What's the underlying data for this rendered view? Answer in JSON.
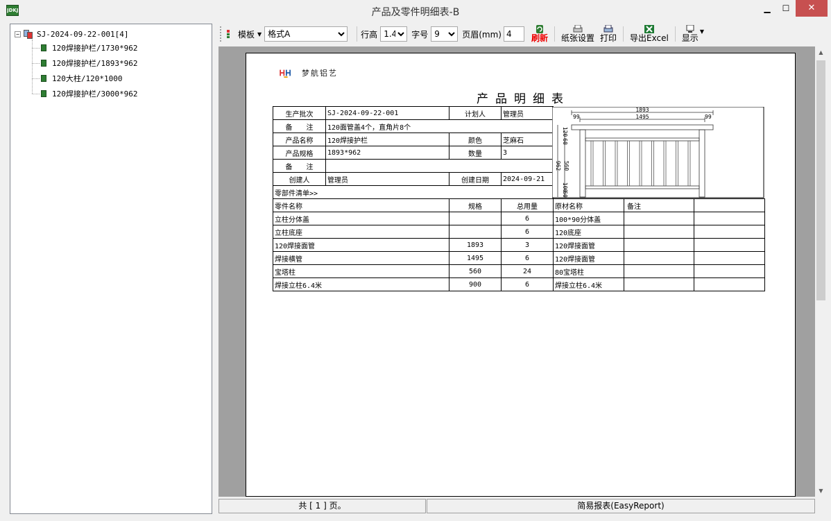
{
  "window": {
    "icon_text": "ZIZ\nJDKJ",
    "title": "产品及零件明细表-B",
    "min_glyph": "▁",
    "max_glyph": "☐",
    "close_glyph": "✕"
  },
  "tree": {
    "root": {
      "expander": "−",
      "label": "SJ-2024-09-22-001[4]"
    },
    "items": [
      {
        "label": "120焊接护栏/1730*962"
      },
      {
        "label": "120焊接护栏/1893*962"
      },
      {
        "label": "120大柱/120*1000"
      },
      {
        "label": "120焊接护栏/3000*962"
      }
    ]
  },
  "toolbar": {
    "template_label": "模板",
    "format_selected": "格式A",
    "row_height_label": "行高",
    "row_height_value": "1.4",
    "font_size_label": "字号",
    "font_size_value": "9",
    "margin_label": "页眉(mm)",
    "margin_value": "4",
    "refresh_label": "刷新",
    "paper_label": "纸张设置",
    "print_label": "打印",
    "export_label": "导出Excel",
    "display_label": "显示",
    "colors": {
      "refresh": "#e00000",
      "excel": "#1e7b34"
    }
  },
  "report": {
    "logo_text": "梦航铝艺",
    "title": "产品明细表",
    "header": {
      "batch_label": "生产批次",
      "batch_value": "SJ-2024-09-22-001",
      "planner_label": "计划人",
      "planner_value": "管理员",
      "note1_label": "备　　注",
      "note1_value": "120面管盖4个，直角片8个",
      "product_label": "产品名称",
      "product_value": "120焊接护栏",
      "color_label": "颜色",
      "color_value": "芝麻石",
      "spec_label": "产品规格",
      "spec_value": "1893*962",
      "qty_label": "数量",
      "qty_value": "3",
      "note2_label": "备　　注",
      "note2_value": "",
      "creator_label": "创建人",
      "creator_value": "管理员",
      "date_label": "创建日期",
      "date_value": "2024-09-21",
      "parts_list_label": "零部件清单>>"
    },
    "drawing": {
      "total_width": "1893",
      "inner_width": "1495",
      "left_offset": "99",
      "right_offset": "99",
      "height": "962",
      "mid_height": "560",
      "top_dim": "120",
      "top_dim2": "60",
      "bottom_dim": "100",
      "bottom_dim2": "60"
    },
    "parts_headers": [
      "零件名称",
      "规格",
      "总用量",
      "原材名称",
      "备注"
    ],
    "parts": [
      {
        "name": "立柱分体盖",
        "spec": "",
        "total": "6",
        "material": "100*90分体盖"
      },
      {
        "name": "立柱底座",
        "spec": "",
        "total": "6",
        "material": "120底座"
      },
      {
        "name": "120焊接面管",
        "spec": "1893",
        "total": "3",
        "material": "120焊接面管"
      },
      {
        "name": "焊接横管",
        "spec": "1495",
        "total": "6",
        "material": "120焊接面管"
      },
      {
        "name": "宝塔柱",
        "spec": "560",
        "total": "24",
        "material": "80宝塔柱"
      },
      {
        "name": "焊接立柱6.4米",
        "spec": "900",
        "total": "6",
        "material": "焊接立柱6.4米"
      }
    ]
  },
  "status": {
    "pages": "共 [ 1 ] 页。",
    "product": "简易报表(EasyReport)"
  }
}
